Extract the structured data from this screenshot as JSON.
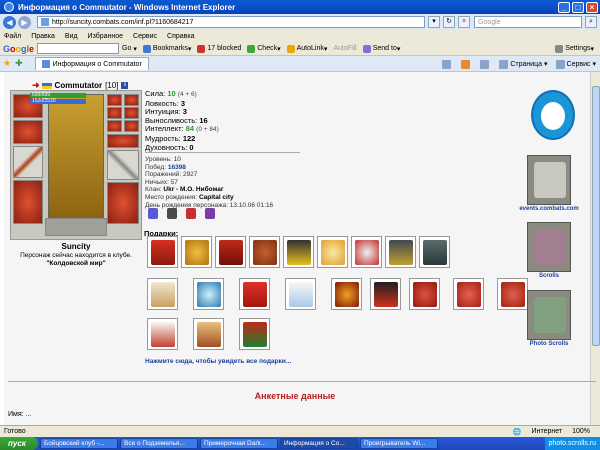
{
  "window": {
    "title": "Информация о Commutator - Windows Internet Explorer"
  },
  "address": {
    "url": "http://suncity.combats.com/inf.pl?1160684217",
    "search_placeholder": "Google"
  },
  "menu": [
    "Файл",
    "Правка",
    "Вид",
    "Избранное",
    "Сервис",
    "Справка"
  ],
  "google": {
    "go": "Go",
    "bookmarks": "Bookmarks",
    "blocked": "17 blocked",
    "check": "Check",
    "autolink": "AutoLink",
    "autofill": "AutoFill",
    "sendto": "Send to",
    "settings": "Settings"
  },
  "tab": {
    "label": "Информация о Commutator"
  },
  "commandbar": {
    "page": "Страница",
    "tools": "Сервис"
  },
  "player": {
    "name": "Commutator",
    "level": "[10]",
    "hp": "699/699",
    "mp": "1520/1520",
    "city": "Suncity",
    "status": "Персонаж сейчас находится в клубе.",
    "location": "\"Колдовской мир\""
  },
  "stats": {
    "sila_label": "Сила:",
    "sila": "10",
    "sila_bonus": "(4 + 6)",
    "lovkost_label": "Ловкость:",
    "lovkost": "3",
    "intuicia_label": "Интуиция:",
    "intuicia": "3",
    "vynoslivost_label": "Выносливость:",
    "vynoslivost": "16",
    "intellekt_label": "Интеллект:",
    "intellekt": "84",
    "intellekt_bonus": "(0 + 84)",
    "mudrost_label": "Мудрость:",
    "mudrost": "122",
    "duhovnost_label": "Духовность:",
    "duhovnost": "0"
  },
  "info": {
    "level_label": "Уровень:",
    "level": "10",
    "wins_label": "Побед:",
    "wins": "16398",
    "losses_label": "Поражений:",
    "losses": "2927",
    "draws_label": "Ничьих:",
    "draws": "57",
    "clan_label": "Клан:",
    "clan": "Ukr - М.О. Нибомаг",
    "birthplace_label": "Место рождения:",
    "birthplace": "Capital city",
    "birthday_label": "День рождения персонажа:",
    "birthday": "13.10.06 01:16"
  },
  "gifts": {
    "label": "Подарки:",
    "more": "Нажмите сюда, чтобы увидеть все подарки..."
  },
  "sidebar": {
    "events": "events.combats.com",
    "scrolls": "Scrolls",
    "photo": "Photo Scrolls"
  },
  "anketa": {
    "title": "Анкетные данные",
    "name_label": "Имя:",
    "name_value": "..."
  },
  "statusbar": {
    "left": "Готово",
    "zone": "Интернет",
    "zoom": "100%"
  },
  "taskbar": {
    "start": "пуск",
    "items": [
      "Бойцовский клуб -...",
      "Все о Подземелья...",
      "Примерочная Dark...",
      "Информация о Co...",
      "Проигрыватель Wi..."
    ],
    "watermark": "photo.scrolls.ru"
  }
}
